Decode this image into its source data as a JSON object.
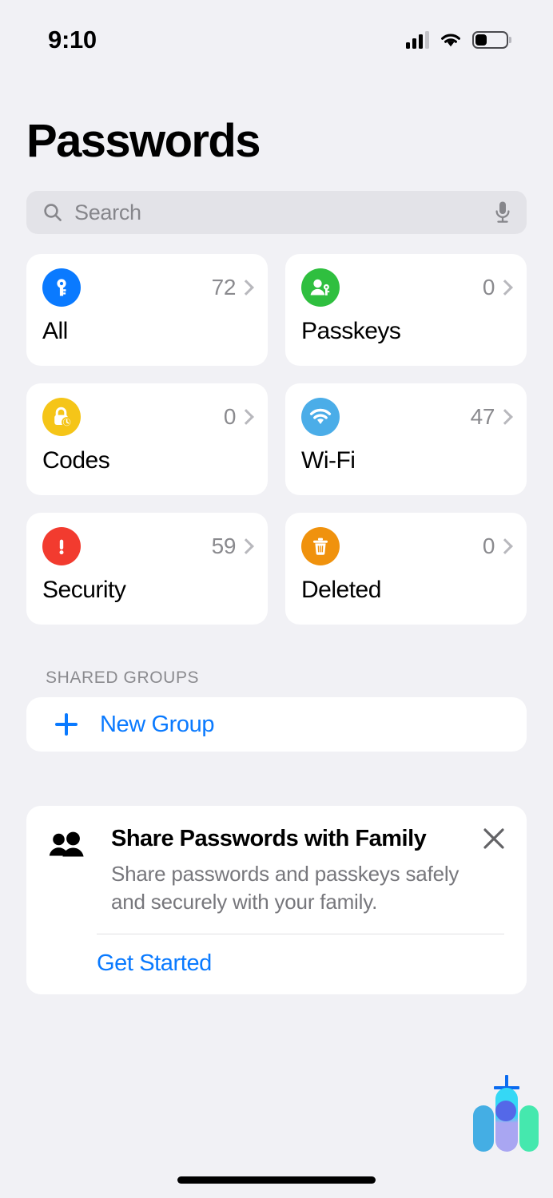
{
  "status_bar": {
    "time": "9:10",
    "cellular_icon": "signal-bars-icon",
    "wifi_icon": "wifi-icon",
    "battery_icon": "battery-icon"
  },
  "header": {
    "title": "Passwords"
  },
  "search": {
    "placeholder": "Search",
    "value": "",
    "search_icon": "search-icon",
    "dictation_icon": "microphone-icon"
  },
  "categories": [
    {
      "label": "All",
      "count": "72",
      "icon": "key-icon",
      "color": "#0A7AFF"
    },
    {
      "label": "Passkeys",
      "count": "0",
      "icon": "person-key-icon",
      "color": "#2FBF3F"
    },
    {
      "label": "Codes",
      "count": "0",
      "icon": "lock-clock-icon",
      "color": "#F5C518"
    },
    {
      "label": "Wi-Fi",
      "count": "47",
      "icon": "wifi-icon",
      "color": "#4BADE8"
    },
    {
      "label": "Security",
      "count": "59",
      "icon": "exclamation-icon",
      "color": "#F23B2F"
    },
    {
      "label": "Deleted",
      "count": "0",
      "icon": "trash-icon",
      "color": "#F0920D"
    }
  ],
  "shared_groups": {
    "section_title": "SHARED GROUPS",
    "new_group_label": "New Group",
    "plus_icon": "plus-icon"
  },
  "family_banner": {
    "icon": "two-people-icon",
    "title": "Share Passwords with Family",
    "description": "Share passwords and passkeys safely and securely with your family.",
    "action_label": "Get Started",
    "close_icon": "close-icon"
  },
  "floating_widget": {
    "plus_icon": "plus-icon",
    "colors": {
      "left_pill": "#44AEE4",
      "mid_pill_top": "#35D8F5",
      "mid_pill_bottom": "#A9A6F2",
      "right_pill": "#45E8AE",
      "dot": "#5468E8",
      "plus": "#0A6BEF"
    }
  },
  "theme": {
    "accent": "#0A7AFF",
    "background": "#F1F1F5",
    "card": "#FFFFFF",
    "secondary_text": "#8A8A8E"
  }
}
